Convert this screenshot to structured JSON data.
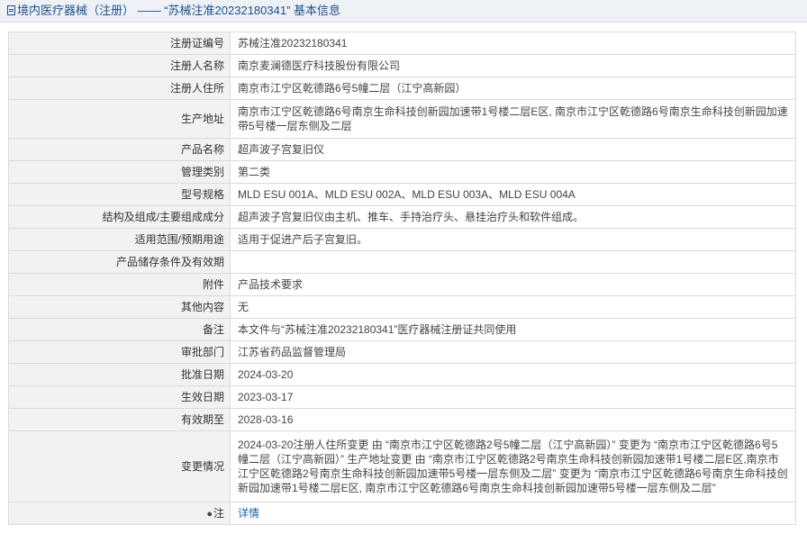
{
  "header": {
    "title": "境内医疗器械（注册） —— “苏械注准20232180341” 基本信息"
  },
  "rows": [
    {
      "label": "注册证编号",
      "value": "苏械注准20232180341"
    },
    {
      "label": "注册人名称",
      "value": "南京麦澜德医疗科技股份有限公司"
    },
    {
      "label": "注册人住所",
      "value": "南京市江宁区乾德路6号5幢二层（江宁高新园）"
    },
    {
      "label": "生产地址",
      "value": "南京市江宁区乾德路6号南京生命科技创新园加速带1号楼二层E区, 南京市江宁区乾德路6号南京生命科技创新园加速带5号楼一层东侧及二层"
    },
    {
      "label": "产品名称",
      "value": "超声波子宫复旧仪"
    },
    {
      "label": "管理类别",
      "value": "第二类"
    },
    {
      "label": "型号规格",
      "value": "MLD ESU 001A、MLD ESU 002A、MLD ESU 003A、MLD ESU 004A"
    },
    {
      "label": "结构及组成/主要组成成分",
      "value": "超声波子宫复旧仪由主机、推车、手持治疗头、悬挂治疗头和软件组成。"
    },
    {
      "label": "适用范围/预期用途",
      "value": "适用于促进产后子宫复旧。"
    },
    {
      "label": "产品储存条件及有效期",
      "value": ""
    },
    {
      "label": "附件",
      "value": "产品技术要求"
    },
    {
      "label": "其他内容",
      "value": "无"
    },
    {
      "label": "备注",
      "value": "本文件与“苏械注准20232180341”医疗器械注册证共同使用"
    },
    {
      "label": "审批部门",
      "value": "江苏省药品监督管理局"
    },
    {
      "label": "批准日期",
      "value": "2024-03-20"
    },
    {
      "label": "生效日期",
      "value": "2023-03-17"
    },
    {
      "label": "有效期至",
      "value": "2028-03-16"
    },
    {
      "label": "变更情况",
      "value": "2024-03-20注册人住所变更 由 “南京市江宁区乾德路2号5幢二层（江宁高新园）” 变更为 “南京市江宁区乾德路6号5幢二层（江宁高新园）” 生产地址变更 由 “南京市江宁区乾德路2号南京生命科技创新园加速带1号楼二层E区,南京市江宁区乾德路2号南京生命科技创新园加速带5号楼一层东侧及二层” 变更为 “南京市江宁区乾德路6号南京生命科技创新园加速带1号楼二层E区, 南京市江宁区乾德路6号南京生命科技创新园加速带5号楼一层东侧及二层”"
    }
  ],
  "note": {
    "label": "注",
    "icon": "pin-icon",
    "link_text": "详情"
  }
}
